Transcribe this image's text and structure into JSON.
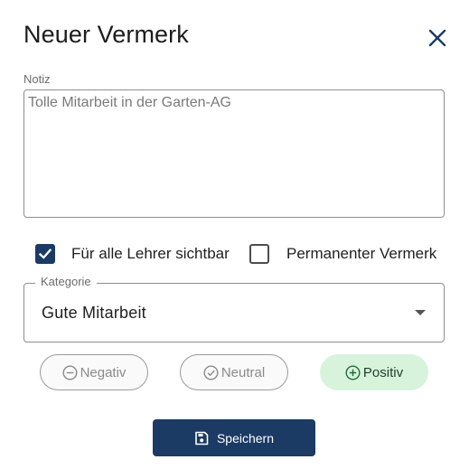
{
  "dialog": {
    "title": "Neuer Vermerk",
    "close_icon": "close-icon"
  },
  "note": {
    "label": "Notiz",
    "value": "Tolle Mitarbeit in der Garten-AG"
  },
  "checkboxes": [
    {
      "label": "Für alle Lehrer sichtbar",
      "checked": true
    },
    {
      "label": "Permanenter Vermerk",
      "checked": false
    }
  ],
  "category": {
    "label": "Kategorie",
    "selected": "Gute Mitarbeit"
  },
  "ratings": [
    {
      "label": "Negativ",
      "icon": "minus-circle-icon",
      "active": false
    },
    {
      "label": "Neutral",
      "icon": "check-circle-icon",
      "active": false
    },
    {
      "label": "Positiv",
      "icon": "plus-circle-icon",
      "active": true
    }
  ],
  "colors": {
    "primary": "#1b3a64",
    "positive_bg": "#d8f3dc"
  },
  "save": {
    "label": "Speichern",
    "icon": "save-icon"
  }
}
